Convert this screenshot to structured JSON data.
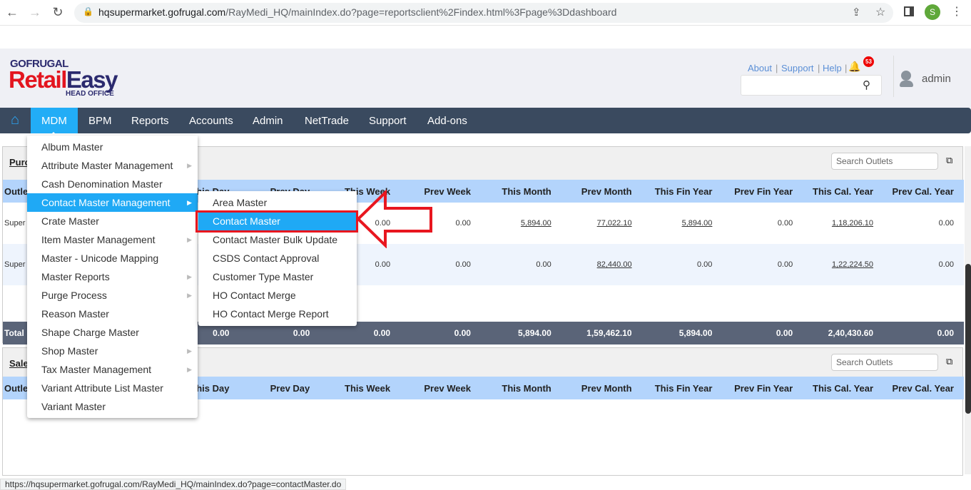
{
  "browser": {
    "url_host": "hqsupermarket.gofrugal.com",
    "url_path": "/RayMedi_HQ/mainIndex.do?page=reportsclient%2Findex.html%3Fpage%3Ddashboard",
    "profile_initial": "S"
  },
  "logo": {
    "brand": "GOFRUGAL",
    "product_a": "Retail",
    "product_b": "Easy",
    "sub": "HEAD OFFICE"
  },
  "header": {
    "links": [
      "About",
      "Support",
      "Help"
    ],
    "notification_count": "53",
    "user": "admin"
  },
  "nav": {
    "items": [
      "MDM",
      "BPM",
      "Reports",
      "Accounts",
      "Admin",
      "NetTrade",
      "Support",
      "Add-ons"
    ]
  },
  "mdm_menu": [
    {
      "label": "Album Master",
      "sub": false
    },
    {
      "label": "Attribute Master Management",
      "sub": true
    },
    {
      "label": "Cash Denomination Master",
      "sub": false
    },
    {
      "label": "Contact Master Management",
      "sub": true
    },
    {
      "label": "Crate Master",
      "sub": false
    },
    {
      "label": "Item Master Management",
      "sub": true
    },
    {
      "label": "Master - Unicode Mapping",
      "sub": false
    },
    {
      "label": "Master Reports",
      "sub": true
    },
    {
      "label": "Purge Process",
      "sub": true
    },
    {
      "label": "Reason Master",
      "sub": false
    },
    {
      "label": "Shape Charge Master",
      "sub": false
    },
    {
      "label": "Shop Master",
      "sub": true
    },
    {
      "label": "Tax Master Management",
      "sub": true
    },
    {
      "label": "Variant Attribute List Master",
      "sub": false
    },
    {
      "label": "Variant Master",
      "sub": false
    }
  ],
  "submenu": [
    "Area Master",
    "Contact Master",
    "Contact Master Bulk Update",
    "CSDS Contact Approval",
    "Customer Type Master",
    "HO Contact Merge",
    "HO Contact Merge Report"
  ],
  "columns": [
    "Outle",
    "This Day",
    "Prev Day",
    "This Week",
    "Prev Week",
    "This Month",
    "Prev Month",
    "This Fin Year",
    "Prev Fin Year",
    "This Cal. Year",
    "Prev Cal. Year"
  ],
  "panel1": {
    "title": "Purc",
    "search_placeholder": "Search Outlets",
    "rows": [
      [
        "Super outlet",
        "",
        "",
        "0.00",
        "0.00",
        "5,894.00",
        "77,022.10",
        "5,894.00",
        "0.00",
        "1,18,206.10",
        "0.00"
      ],
      [
        "Super Wareh",
        "",
        "",
        "0.00",
        "0.00",
        "0.00",
        "82,440.00",
        "0.00",
        "0.00",
        "1,22,224.50",
        "0.00"
      ]
    ],
    "total": [
      "Total",
      "0.00",
      "0.00",
      "0.00",
      "0.00",
      "5,894.00",
      "1,59,462.10",
      "5,894.00",
      "0.00",
      "2,40,430.60",
      "0.00"
    ]
  },
  "panel2": {
    "title": "Sale",
    "search_placeholder": "Search Outlets"
  },
  "status_url": "https://hqsupermarket.gofrugal.com/RayMedi_HQ/mainIndex.do?page=contactMaster.do"
}
